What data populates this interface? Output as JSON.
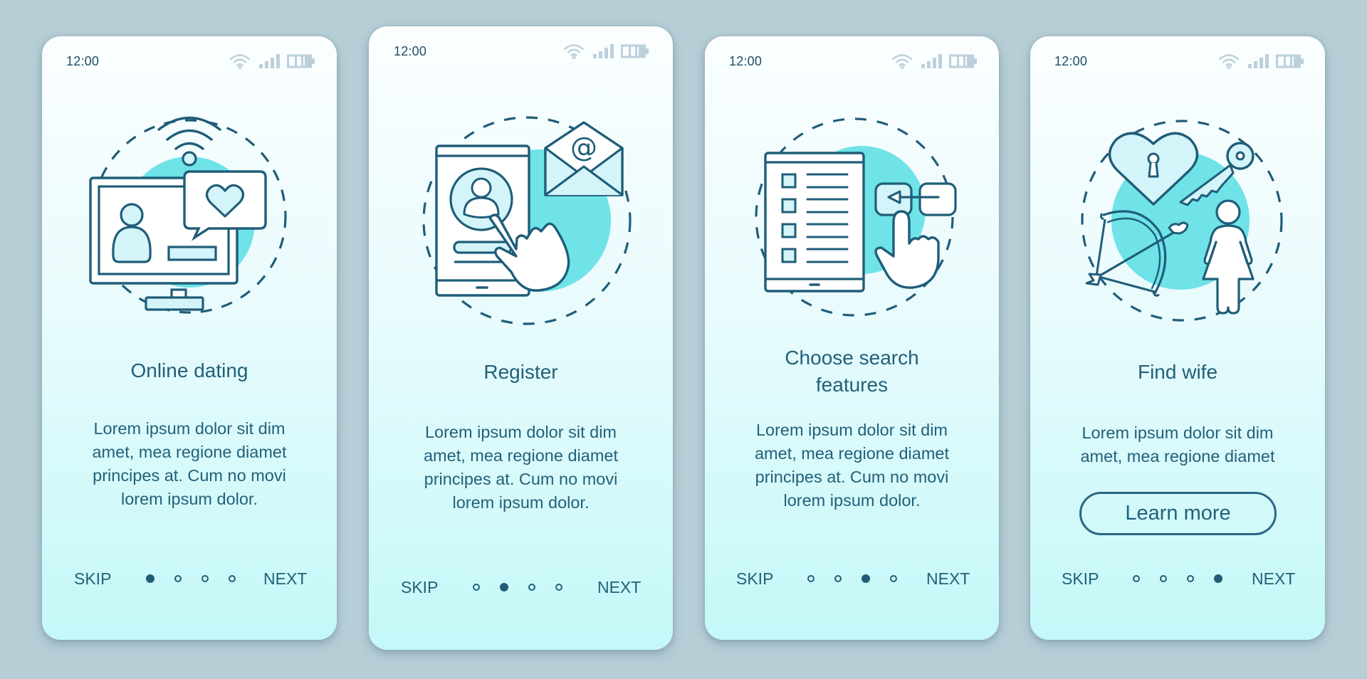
{
  "status_bar": {
    "time": "12:00",
    "icons": [
      "wifi-icon",
      "signal-icon",
      "battery-icon"
    ]
  },
  "colors": {
    "background": "#b7ced7",
    "accent": "#1f5d78",
    "illustration_fill": "#6fe3e8",
    "illustration_light": "#d3f4f9",
    "status_icon": "#bcd0db"
  },
  "screens": [
    {
      "title": "Online dating",
      "illustration": "computer-dating-icon",
      "body": [
        "Lorem ipsum dolor sit dim",
        "amet, mea regione diamet",
        "principes at. Cum no movi",
        "lorem ipsum dolor."
      ],
      "skip_label": "SKIP",
      "next_label": "NEXT",
      "page_index": 1,
      "page_count": 4
    },
    {
      "title": "Register",
      "illustration": "register-phone-email-icon",
      "body": [
        "Lorem ipsum dolor sit dim",
        "amet, mea regione diamet",
        "principes at. Cum no movi",
        "lorem ipsum dolor."
      ],
      "skip_label": "SKIP",
      "next_label": "NEXT",
      "page_index": 2,
      "page_count": 4
    },
    {
      "title": [
        "Choose search",
        "features"
      ],
      "illustration": "search-features-icon",
      "body": [
        "Lorem ipsum dolor sit dim",
        "amet, mea regione diamet",
        "principes at. Cum no movi",
        "lorem ipsum dolor."
      ],
      "skip_label": "SKIP",
      "next_label": "NEXT",
      "page_index": 3,
      "page_count": 4
    },
    {
      "title": "Find wife",
      "illustration": "find-wife-icon",
      "body": [
        "Lorem ipsum dolor sit dim",
        "amet, mea regione diamet"
      ],
      "button_label": "Learn more",
      "skip_label": "SKIP",
      "next_label": "NEXT",
      "page_index": 4,
      "page_count": 4
    }
  ]
}
